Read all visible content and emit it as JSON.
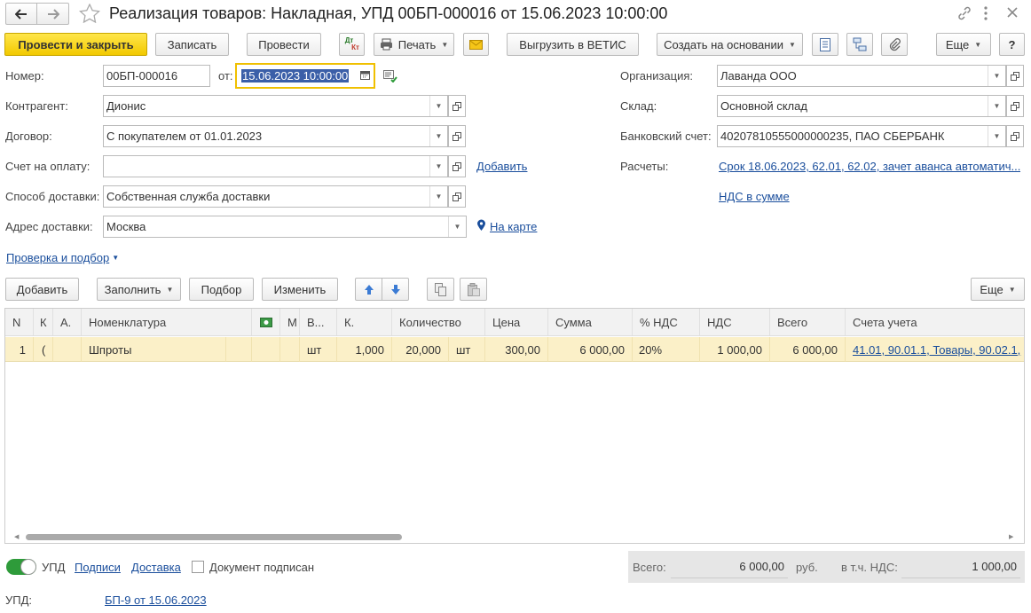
{
  "title": "Реализация товаров: Накладная, УПД 00БП-000016 от 15.06.2023 10:00:00",
  "toolbar": {
    "post_close": "Провести и закрыть",
    "save": "Записать",
    "post": "Провести",
    "dtkt_top": "Дт",
    "dtkt_bottom": "Кт",
    "print": "Печать",
    "export": "Выгрузить в ВЕТИС",
    "create_based": "Создать на основании",
    "more": "Еще",
    "help": "?"
  },
  "form": {
    "number_label": "Номер:",
    "number": "00БП-000016",
    "date_label": "от:",
    "date": "15.06.2023 10:00:00",
    "contractor_label": "Контрагент:",
    "contractor": "Дионис",
    "contract_label": "Договор:",
    "contract": "С покупателем от 01.01.2023",
    "invoice_label": "Счет на оплату:",
    "invoice": "",
    "add_link": "Добавить",
    "delivery_method_label": "Способ доставки:",
    "delivery_method": "Собственная служба доставки",
    "address_label": "Адрес доставки:",
    "address": "Москва",
    "map_link": "На карте",
    "org_label": "Организация:",
    "org": "Лаванда ООО",
    "warehouse_label": "Склад:",
    "warehouse": "Основной склад",
    "bank_label": "Банковский счет:",
    "bank": "40207810555000000235, ПАО СБЕРБАНК",
    "settlements_label": "Расчеты:",
    "settlements": "Срок 18.06.2023, 62.01, 62.02, зачет аванса автоматич...",
    "vat_link": "НДС в сумме",
    "check_link": "Проверка и подбор"
  },
  "table_toolbar": {
    "add": "Добавить",
    "fill": "Заполнить",
    "pick": "Подбор",
    "change": "Изменить",
    "more": "Еще"
  },
  "table": {
    "headers": [
      "N",
      "К",
      "А.",
      "Номенклатура",
      "",
      "М",
      "В...",
      "К.",
      "Количество",
      "Цена",
      "Сумма",
      "% НДС",
      "НДС",
      "Всего",
      "Счета учета"
    ],
    "rows": [
      {
        "n": "1",
        "k": "(",
        "a": "",
        "item": "Шпроты",
        "unit_b": "шт",
        "k2": "1,000",
        "qty": "20,000",
        "qty_unit": "шт",
        "price": "300,00",
        "sum": "6 000,00",
        "vat_rate": "20%",
        "vat": "1 000,00",
        "total": "6 000,00",
        "accounts": "41.01, 90.01.1, Товары, 90.02.1,"
      }
    ]
  },
  "footer": {
    "upd_toggle": "УПД",
    "signers_link": "Подписи",
    "delivery_link": "Доставка",
    "signed_label": "Документ подписан",
    "total_label": "Всего:",
    "total": "6 000,00",
    "currency": "руб.",
    "vat_label": "в т.ч. НДС:",
    "vat": "1 000,00",
    "upd_label": "УПД:",
    "upd_link": "БП-9 от 15.06.2023"
  }
}
